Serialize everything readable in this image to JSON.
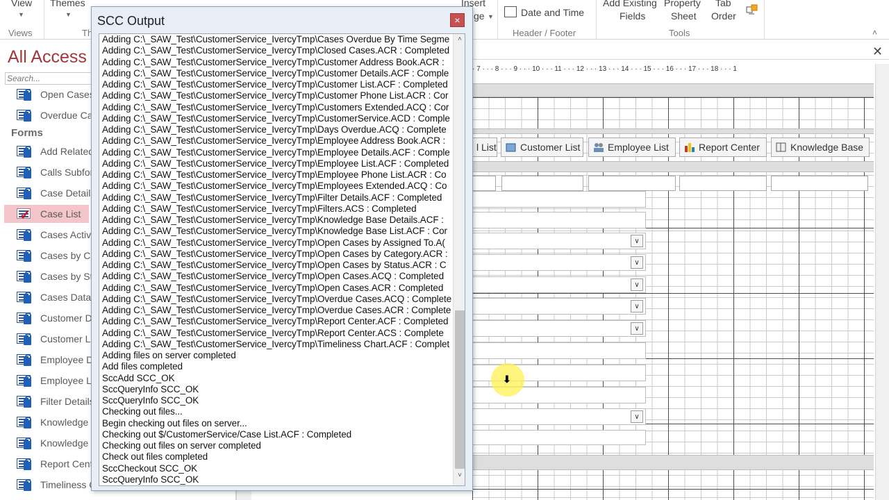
{
  "ribbon": {
    "view_label": "View",
    "themes_label": "Themes",
    "views_group": "Views",
    "themes_group_partial": "Th",
    "insert_label_partial": "Insert",
    "image_label_partial": "ge",
    "date_time_label": "Date and Time",
    "header_footer_group": "Header / Footer",
    "add_existing_fields_line1": "Add Existing",
    "add_existing_fields_line2": "Fields",
    "property_sheet_line1": "Property",
    "property_sheet_line2": "Sheet",
    "tab_order_line1": "Tab",
    "tab_order_line2": "Order",
    "tools_group": "Tools"
  },
  "nav": {
    "title": "All Access",
    "search_placeholder": "Search...",
    "items_top": [
      {
        "label": "Open Cases",
        "icon": "report-icon"
      },
      {
        "label": "Overdue Ca",
        "icon": "report-icon"
      }
    ],
    "forms_heading": "Forms",
    "forms": [
      {
        "label": "Add Related",
        "icon": "form-icon"
      },
      {
        "label": "Calls Subfor",
        "icon": "form-icon"
      },
      {
        "label": "Case Details",
        "icon": "form-icon"
      },
      {
        "label": "Case List",
        "icon": "form-checked-out-icon",
        "selected": true
      },
      {
        "label": "Cases Active",
        "icon": "form-icon"
      },
      {
        "label": "Cases by Cat",
        "icon": "form-icon"
      },
      {
        "label": "Cases by Sta",
        "icon": "form-icon"
      },
      {
        "label": "Cases Datas",
        "icon": "form-icon"
      },
      {
        "label": "Customer D",
        "icon": "form-icon"
      },
      {
        "label": "Customer Li",
        "icon": "form-icon"
      },
      {
        "label": "Employee D",
        "icon": "form-icon"
      },
      {
        "label": "Employee Li",
        "icon": "form-icon"
      },
      {
        "label": "Filter Details",
        "icon": "form-icon"
      },
      {
        "label": "Knowledge",
        "icon": "form-icon"
      },
      {
        "label": "Knowledge",
        "icon": "form-icon"
      },
      {
        "label": "Report Cent",
        "icon": "form-icon"
      },
      {
        "label": "Timeliness C",
        "icon": "form-icon"
      }
    ]
  },
  "design": {
    "ruler_text": "· 7 · · · 8 · · · 9 · · · 10 · · · 11 · · · 12 · · · 13 · · · 14 · · · 15 · · · 16 · · · 17 · · · 18 · · · 1",
    "nav_buttons": [
      {
        "label": "l List",
        "icon": "list-icon"
      },
      {
        "label": "Customer List",
        "icon": "customer-icon"
      },
      {
        "label": "Employee List",
        "icon": "employee-icon"
      },
      {
        "label": "Report Center",
        "icon": "report-center-icon"
      },
      {
        "label": "Knowledge Base",
        "icon": "book-icon"
      }
    ],
    "dropdown_glyph": "∨",
    "cursor_glyph": "🠛"
  },
  "scc": {
    "title": "SCC Output",
    "close_glyph": "×",
    "scroll_up": "˄",
    "scroll_down": "˅",
    "lines": [
      "Adding C:\\_SAW_Test\\CustomerService_IvercyTmp\\Cases Overdue By Time Segme",
      "Adding C:\\_SAW_Test\\CustomerService_IvercyTmp\\Closed Cases.ACR : Completed",
      "Adding C:\\_SAW_Test\\CustomerService_IvercyTmp\\Customer Address Book.ACR :",
      "Adding C:\\_SAW_Test\\CustomerService_IvercyTmp\\Customer Details.ACF : Comple",
      "Adding C:\\_SAW_Test\\CustomerService_IvercyTmp\\Customer List.ACF : Completed",
      "Adding C:\\_SAW_Test\\CustomerService_IvercyTmp\\Customer Phone List.ACR : Cor",
      "Adding C:\\_SAW_Test\\CustomerService_IvercyTmp\\Customers Extended.ACQ : Cor",
      "Adding C:\\_SAW_Test\\CustomerService_IvercyTmp\\CustomerService.ACD : Comple",
      "Adding C:\\_SAW_Test\\CustomerService_IvercyTmp\\Days Overdue.ACQ : Complete",
      "Adding C:\\_SAW_Test\\CustomerService_IvercyTmp\\Employee Address Book.ACR :",
      "Adding C:\\_SAW_Test\\CustomerService_IvercyTmp\\Employee Details.ACF : Comple",
      "Adding C:\\_SAW_Test\\CustomerService_IvercyTmp\\Employee List.ACF : Completed",
      "Adding C:\\_SAW_Test\\CustomerService_IvercyTmp\\Employee Phone List.ACR : Co",
      "Adding C:\\_SAW_Test\\CustomerService_IvercyTmp\\Employees Extended.ACQ : Co",
      "Adding C:\\_SAW_Test\\CustomerService_IvercyTmp\\Filter Details.ACF : Completed",
      "Adding C:\\_SAW_Test\\CustomerService_IvercyTmp\\Filters.ACS : Completed",
      "Adding C:\\_SAW_Test\\CustomerService_IvercyTmp\\Knowledge Base Details.ACF :",
      "Adding C:\\_SAW_Test\\CustomerService_IvercyTmp\\Knowledge Base List.ACF : Cor",
      "Adding C:\\_SAW_Test\\CustomerService_IvercyTmp\\Open Cases by Assigned To.A(",
      "Adding C:\\_SAW_Test\\CustomerService_IvercyTmp\\Open Cases by Category.ACR :",
      "Adding C:\\_SAW_Test\\CustomerService_IvercyTmp\\Open Cases by Status.ACR : C",
      "Adding C:\\_SAW_Test\\CustomerService_IvercyTmp\\Open Cases.ACQ : Completed",
      "Adding C:\\_SAW_Test\\CustomerService_IvercyTmp\\Open Cases.ACR : Completed",
      "Adding C:\\_SAW_Test\\CustomerService_IvercyTmp\\Overdue Cases.ACQ : Complete",
      "Adding C:\\_SAW_Test\\CustomerService_IvercyTmp\\Overdue Cases.ACR : Complete",
      "Adding C:\\_SAW_Test\\CustomerService_IvercyTmp\\Report Center.ACF : Completed",
      "Adding C:\\_SAW_Test\\CustomerService_IvercyTmp\\Report Center.ACS : Complete",
      "Adding C:\\_SAW_Test\\CustomerService_IvercyTmp\\Timeliness Chart.ACF : Complet",
      "Adding files on server completed",
      "Add files completed",
      "SccAdd SCC_OK",
      "SccQueryInfo SCC_OK",
      "SccQueryInfo SCC_OK",
      "Checking out files...",
      "Begin checking out files on server...",
      "Checking out $/CustomerService/Case List.ACF : Completed",
      "Checking out files on server completed",
      "Check out files completed",
      "SccCheckout SCC_OK",
      "SccQueryInfo SCC_OK"
    ]
  }
}
